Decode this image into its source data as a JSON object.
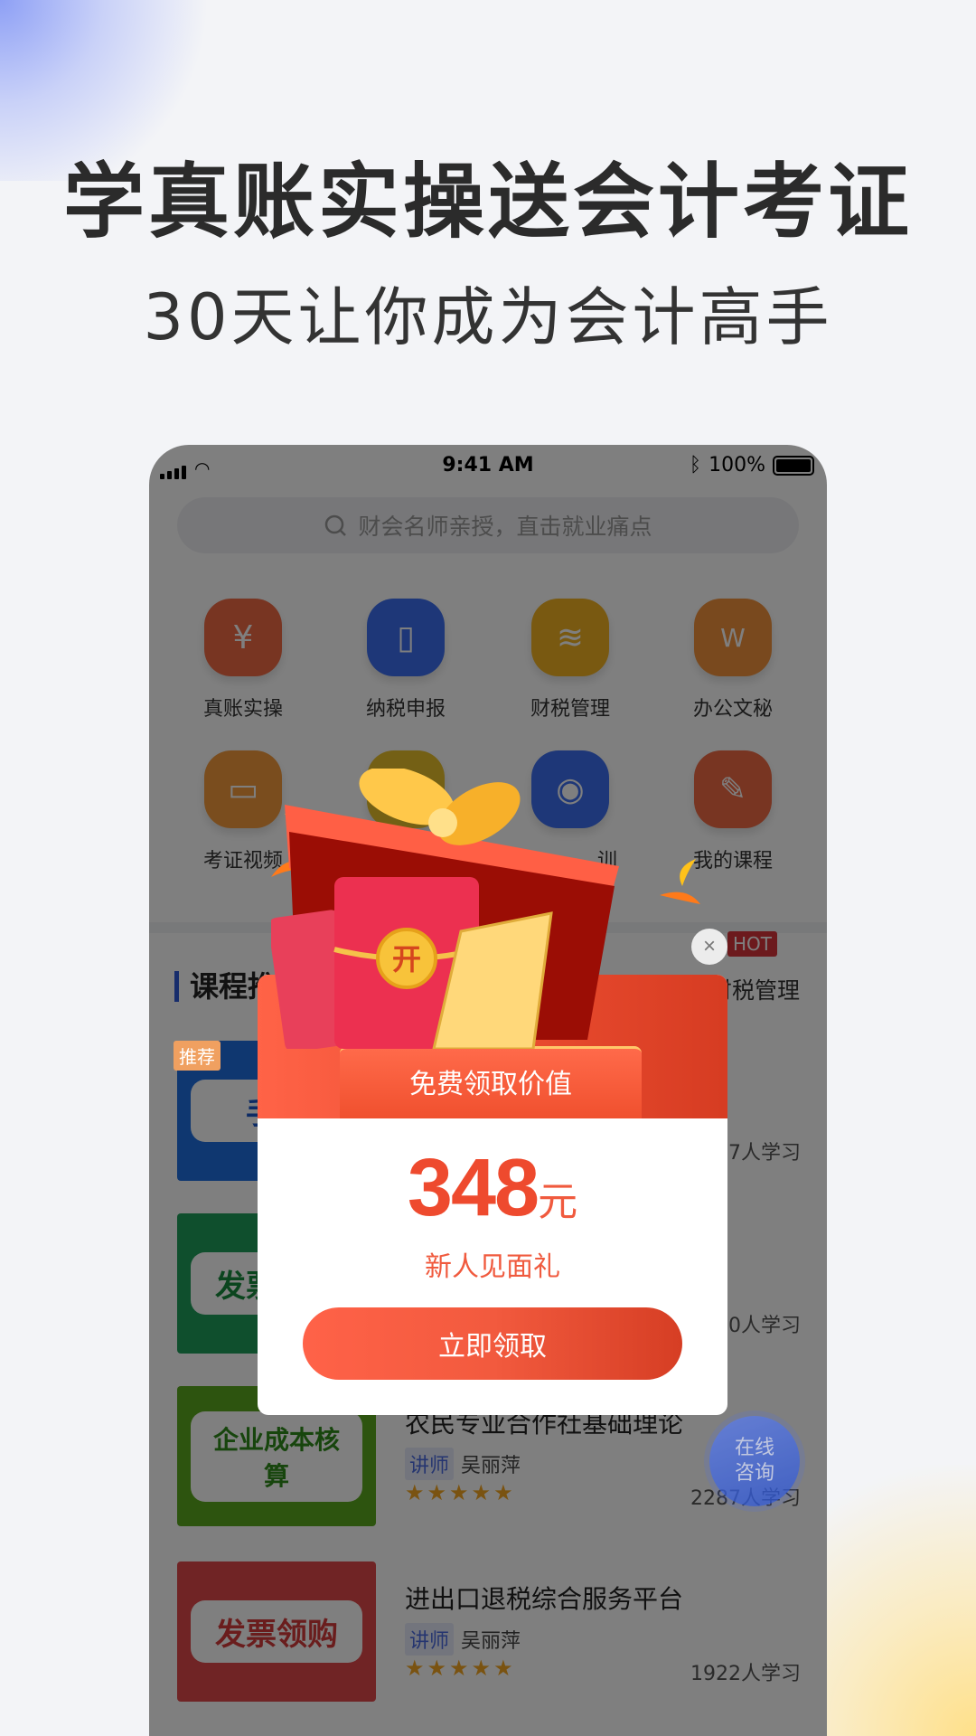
{
  "promo": {
    "headline": "学真账实操送会计考证",
    "subline": "30天让你成为会计高手"
  },
  "status": {
    "time": "9:41 AM",
    "battery": "100%"
  },
  "search": {
    "placeholder": "财会名师亲授，直击就业痛点"
  },
  "categories": [
    {
      "label": "真账实操",
      "icon": "yen-hand-icon",
      "color": "#f06a45"
    },
    {
      "label": "纳税申报",
      "icon": "tax-document-icon",
      "color": "#3d6ff0"
    },
    {
      "label": "财税管理",
      "icon": "coins-stack-icon",
      "color": "#f2b222"
    },
    {
      "label": "办公文秘",
      "icon": "word-document-icon",
      "color": "#f2923c"
    },
    {
      "label": "考证视频",
      "icon": "video-camera-icon",
      "color": "#f49a3c"
    },
    {
      "label": "",
      "icon": "layers-icon",
      "color": "#e8c02a"
    },
    {
      "label": "训",
      "icon": "training-icon",
      "color": "#3d6ff0"
    },
    {
      "label": "我的课程",
      "icon": "my-course-icon",
      "color": "#f06a45"
    }
  ],
  "section": {
    "title": "课程推荐",
    "tab": "财税管理",
    "hot_badge": "HOT"
  },
  "courses": [
    {
      "thumb": "手工",
      "badge": "推荐",
      "title": "",
      "teacher_tag": "",
      "teacher": "",
      "count": "7人学习",
      "thumb_bg": "#1f6fe0",
      "thumb_fg": "#1a56c8"
    },
    {
      "thumb": "发票增量",
      "title": "",
      "teacher_tag": "",
      "teacher": "",
      "count": "0人学习",
      "thumb_bg": "#1f9e5a",
      "thumb_fg": "#168a3c"
    },
    {
      "thumb": "企业成本核算",
      "title": "农民专业合作社基础理论",
      "teacher_tag": "讲师",
      "teacher": "吴丽萍",
      "count": "2287人学习",
      "thumb_bg": "#5aa81e",
      "thumb_fg": "#2f8a1a"
    },
    {
      "thumb": "发票领购",
      "title": "进出口退税综合服务平台",
      "teacher_tag": "讲师",
      "teacher": "吴丽萍",
      "count": "1922人学习",
      "thumb_bg": "#e0484a",
      "thumb_fg": "#d43a3a"
    }
  ],
  "rating_stars": 5,
  "modal": {
    "banner": "免费领取价值",
    "amount": "348",
    "unit": "元",
    "subtitle": "新人见面礼",
    "button": "立即领取",
    "envelope_char": "开"
  },
  "consult": {
    "line1": "在线",
    "line2": "咨询"
  },
  "colors": {
    "accent": "#ee4a2e",
    "blue": "#2f5bd8"
  }
}
